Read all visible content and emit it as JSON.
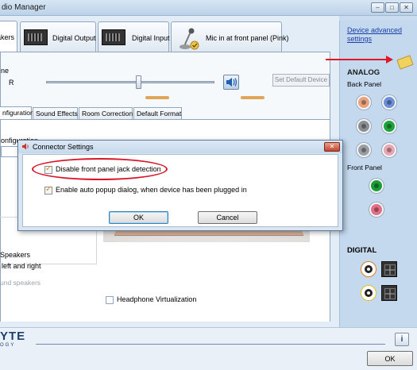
{
  "window": {
    "title": "dio Manager",
    "min_glyph": "–",
    "max_glyph": "□",
    "close_glyph": "✕"
  },
  "tabs": [
    {
      "label": "akers"
    },
    {
      "label": "Digital Output"
    },
    {
      "label": "Digital Input"
    },
    {
      "label": "Mic in at front panel (Pink)"
    }
  ],
  "volume": {
    "label": "ne",
    "channel_label": "R",
    "level": 0.55,
    "set_default_label": "Set Default Device"
  },
  "subtabs": [
    {
      "label": "nfiguration"
    },
    {
      "label": "Sound Effects"
    },
    {
      "label": "Room Correction"
    },
    {
      "label": "Default Format"
    }
  ],
  "config": {
    "label": "onfiguration"
  },
  "speaker_group": {
    "title": "Speakers",
    "left_right": "left and right",
    "surround": "und speakers"
  },
  "headphone_virtualization_label": "Headphone Virtualization",
  "side": {
    "advanced_link": "Device advanced settings",
    "analog_title": "ANALOG",
    "back_panel_label": "Back Panel",
    "front_panel_label": "Front Panel",
    "digital_title": "DIGITAL",
    "jack_colors": {
      "peach": "#e8a27e",
      "blue": "#6b8fd9",
      "grey": "#8a8d92",
      "green": "#1fa33b",
      "grey2": "#9a9da2",
      "pink": "#e8a6b2",
      "front_green": "#1a9c36",
      "front_pink": "#e26f86"
    }
  },
  "bottom": {
    "brand": "YTE",
    "brand_sub": "OGY",
    "info_label": "i",
    "ok_label": "OK"
  },
  "dialog": {
    "title": "Connector Settings",
    "close_glyph": "✕",
    "option1_label": "Disable front panel jack detection",
    "option2_label": "Enable auto popup dialog, when device has been plugged in",
    "ok_label": "OK",
    "cancel_label": "Cancel"
  },
  "colors": {
    "annotation_red": "#e0182a"
  }
}
